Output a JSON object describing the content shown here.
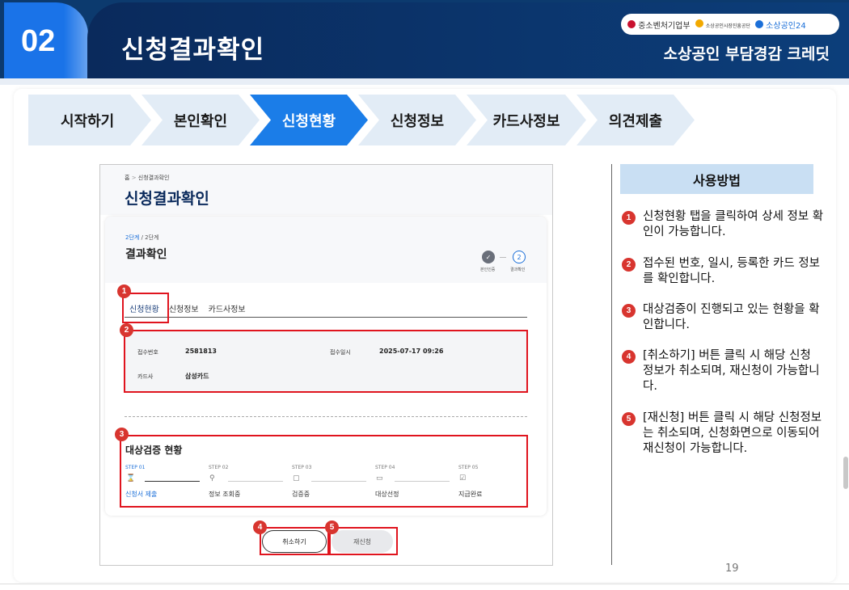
{
  "header": {
    "number": "02",
    "title": "신청결과확인",
    "subtitle": "소상공인 부담경감 크레딧",
    "logos": [
      "중소벤처기업부",
      "소상공인시장진흥공단",
      "소상공인24"
    ]
  },
  "steps": [
    "시작하기",
    "본인확인",
    "신청현황",
    "신청정보",
    "카드사정보",
    "의견제출"
  ],
  "active_step": "신청현황",
  "screen": {
    "breadcrumb_home": "홈",
    "breadcrumb_sep": ">",
    "breadcrumb_current": "신청결과확인",
    "page_title": "신청결과확인",
    "stage_current": "2단계",
    "stage_total": " / 2단계",
    "stage_title": "결과확인",
    "progress": [
      {
        "mark": "✓",
        "label": "본인인증"
      },
      {
        "mark": "2",
        "label": "결과확인"
      }
    ],
    "tabs": [
      "신청현황",
      "신청정보",
      "카드사정보"
    ],
    "info": {
      "receipt_no_label": "접수번호",
      "receipt_no": "2581813",
      "receipt_date_label": "접수일시",
      "receipt_date": "2025-07-17 09:26",
      "card_label": "카드사",
      "card": "삼성카드"
    },
    "verify_title": "대상검증 현황",
    "verify_steps": [
      {
        "step": "STEP 01",
        "label": "신청서 제출",
        "icon": "⌛"
      },
      {
        "step": "STEP 02",
        "label": "정보 조회중",
        "icon": "⚲"
      },
      {
        "step": "STEP 03",
        "label": "검증중",
        "icon": "▢"
      },
      {
        "step": "STEP 04",
        "label": "대상선정",
        "icon": "▭"
      },
      {
        "step": "STEP 05",
        "label": "지급완료",
        "icon": "☑"
      }
    ],
    "cancel_button": "취소하기",
    "reapply_button": "재신청"
  },
  "badges": [
    "1",
    "2",
    "3",
    "4",
    "5"
  ],
  "usage": {
    "title": "사용방법",
    "items": [
      {
        "num": "1",
        "text": "신청현황 탭을 클릭하여 상세 정보 확인이 가능합니다."
      },
      {
        "num": "2",
        "text": "접수된 번호, 일시, 등록한 카드 정보를 확인합니다."
      },
      {
        "num": "3",
        "text": "대상검증이 진행되고 있는 현황을 확인합니다."
      },
      {
        "num": "4",
        "text": "[취소하기] 버튼 클릭 시 해당 신청 정보가 취소되며, 재신청이 가능합니다."
      },
      {
        "num": "5",
        "text": "[재신청] 버튼 클릭 시 해당 신청정보는 취소되며, 신청화면으로 이동되어 재신청이 가능합니다."
      }
    ]
  },
  "page_number": "19",
  "colors": {
    "navy": "#0c3a6e",
    "accent": "#1b7de8",
    "step_bg": "#e2ecf6",
    "red": "#e0141e"
  }
}
